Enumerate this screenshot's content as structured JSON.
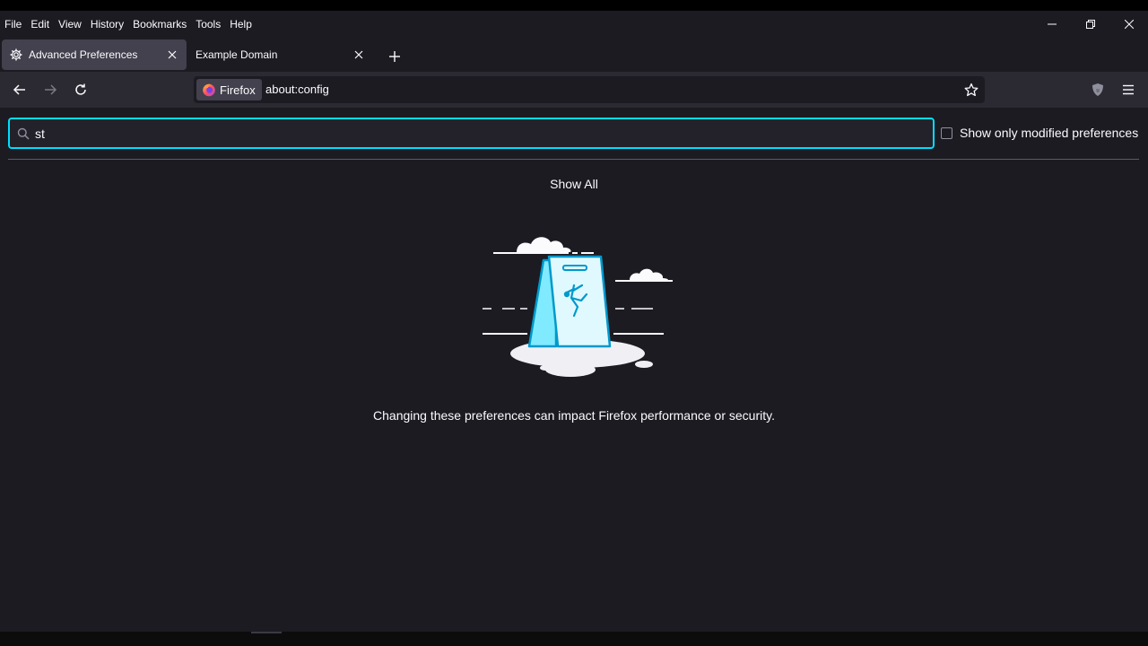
{
  "menu": [
    "File",
    "Edit",
    "View",
    "History",
    "Bookmarks",
    "Tools",
    "Help"
  ],
  "tabs": [
    {
      "label": "Advanced Preferences",
      "icon": "gear-icon",
      "active": true
    },
    {
      "label": "Example Domain",
      "icon": "",
      "active": false
    }
  ],
  "urlbar": {
    "identity_label": "Firefox",
    "url": "about:config"
  },
  "search": {
    "value": "st",
    "placeholder": ""
  },
  "modified_checkbox": {
    "label": "Show only modified preferences",
    "checked": false
  },
  "show_all_label": "Show All",
  "warning_text": "Changing these preferences can impact Firefox performance or security.",
  "colors": {
    "accent": "#00ddff",
    "background": "#1c1b22",
    "toolbar": "#2b2a33",
    "text": "#fbfbfe"
  }
}
